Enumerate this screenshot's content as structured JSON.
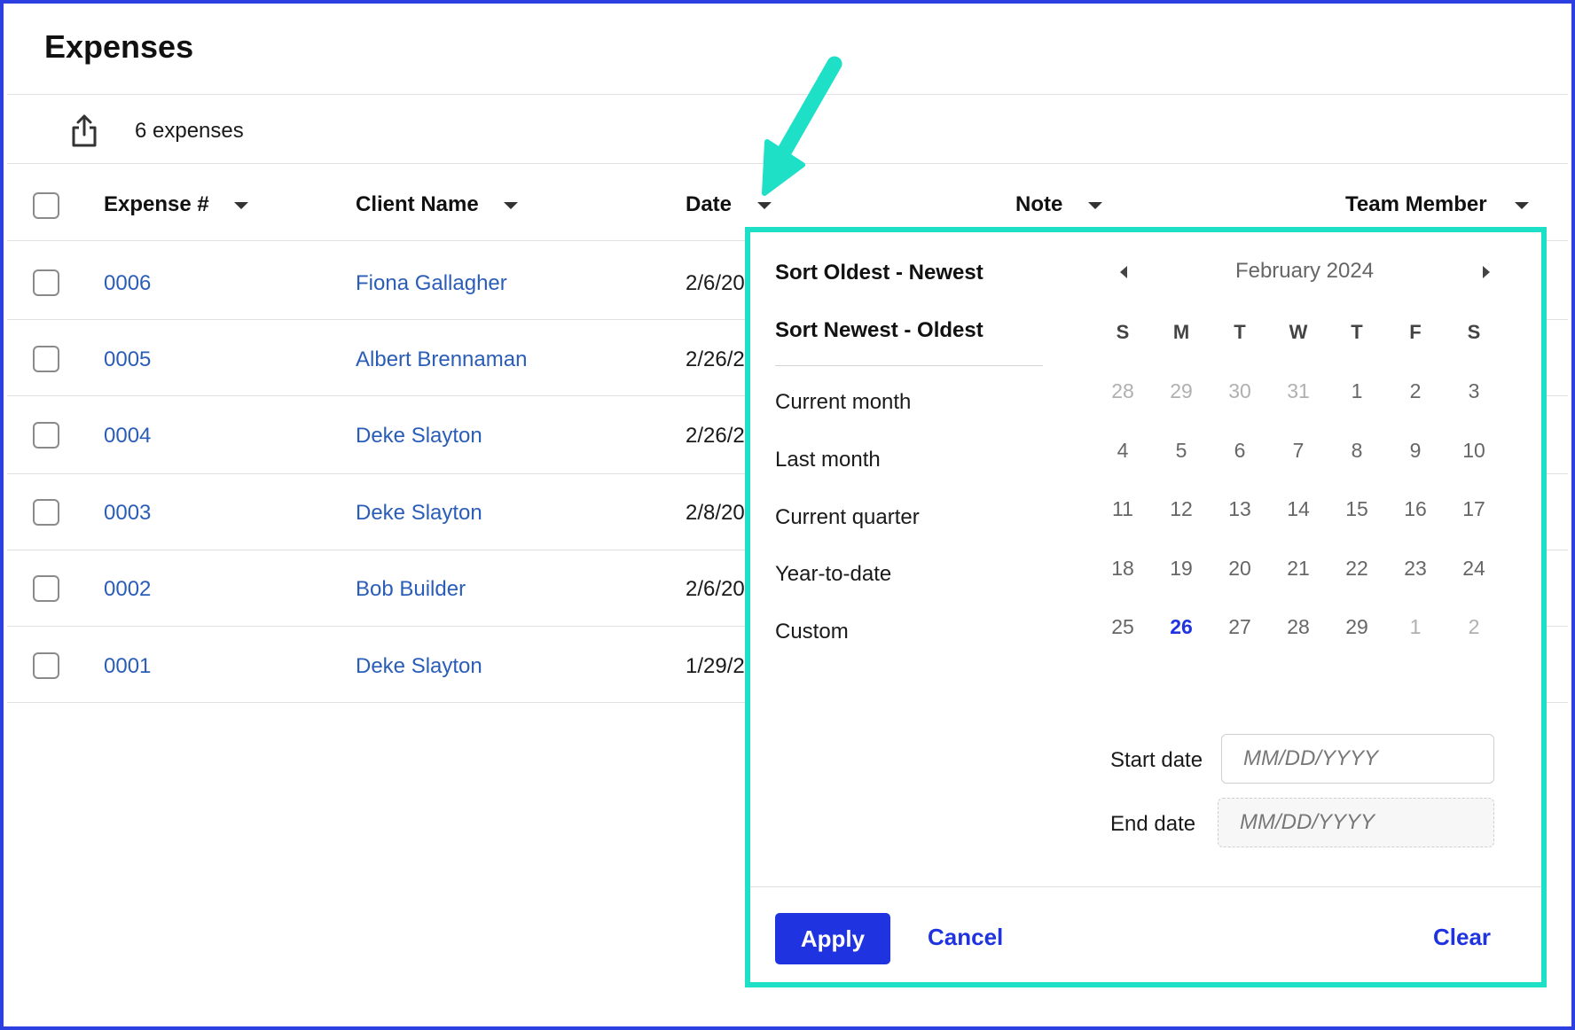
{
  "page": {
    "title": "Expenses"
  },
  "toolbar": {
    "share_icon": "share-icon",
    "count_label": "6 expenses"
  },
  "table": {
    "columns": [
      {
        "label": "Expense #"
      },
      {
        "label": "Client Name"
      },
      {
        "label": "Date"
      },
      {
        "label": "Note"
      },
      {
        "label": "Team Member"
      }
    ],
    "rows": [
      {
        "expense": "0006",
        "client": "Fiona Gallagher",
        "date": "2/6/20"
      },
      {
        "expense": "0005",
        "client": "Albert Brennaman",
        "date": "2/26/2"
      },
      {
        "expense": "0004",
        "client": "Deke Slayton",
        "date": "2/26/2"
      },
      {
        "expense": "0003",
        "client": "Deke Slayton",
        "date": "2/8/20"
      },
      {
        "expense": "0002",
        "client": "Bob Builder",
        "date": "2/6/20"
      },
      {
        "expense": "0001",
        "client": "Deke Slayton",
        "date": "1/29/2"
      }
    ]
  },
  "date_filter": {
    "sort_options": [
      "Sort Oldest - Newest",
      "Sort Newest - Oldest"
    ],
    "presets": [
      "Current month",
      "Last month",
      "Current quarter",
      "Year-to-date",
      "Custom"
    ],
    "calendar": {
      "month_label": "February 2024",
      "weekdays": [
        "S",
        "M",
        "T",
        "W",
        "T",
        "F",
        "S"
      ],
      "weeks": [
        [
          "28",
          "29",
          "30",
          "31",
          "1",
          "2",
          "3"
        ],
        [
          "4",
          "5",
          "6",
          "7",
          "8",
          "9",
          "10"
        ],
        [
          "11",
          "12",
          "13",
          "14",
          "15",
          "16",
          "17"
        ],
        [
          "18",
          "19",
          "20",
          "21",
          "22",
          "23",
          "24"
        ],
        [
          "25",
          "26",
          "27",
          "28",
          "29",
          "1",
          "2"
        ]
      ],
      "today": "26"
    },
    "start_label": "Start date",
    "start_placeholder": "MM/DD/YYYY",
    "end_label": "End date",
    "end_placeholder": "MM/DD/YYYY",
    "apply_label": "Apply",
    "cancel_label": "Cancel",
    "clear_label": "Clear"
  },
  "colors": {
    "frame": "#2c3fe0",
    "highlight": "#1de0c6",
    "accent": "#1f33e0",
    "link": "#2a5db8"
  }
}
